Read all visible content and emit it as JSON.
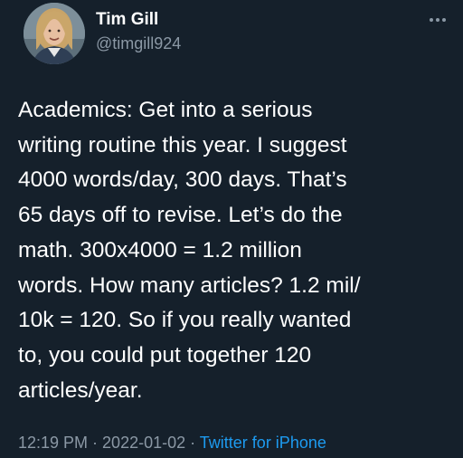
{
  "author": {
    "name": "Tim Gill",
    "handle": "@timgill924",
    "avatar_icon": "user-photo-avatar"
  },
  "menu_icon": "more-options-icon",
  "tweet": {
    "lines": [
      "Academics: Get into a serious",
      "writing routine this year. I suggest",
      "4000 words/day, 300 days. That’s",
      "65 days off to revise. Let’s do the",
      "math. 300x4000 = 1.2 million",
      "words. How many articles? 1.2 mil/",
      "10k = 120. So if you really wanted",
      "to, you could put together 120",
      "articles/year."
    ]
  },
  "meta": {
    "time": "12:19 PM",
    "sep1": " · ",
    "date": "2022-01-02",
    "sep2": " · ",
    "source": "Twitter for iPhone"
  },
  "colors": {
    "background": "#15202b",
    "text": "#ffffff",
    "secondary": "#8b98a5",
    "link": "#1d9bf0"
  }
}
